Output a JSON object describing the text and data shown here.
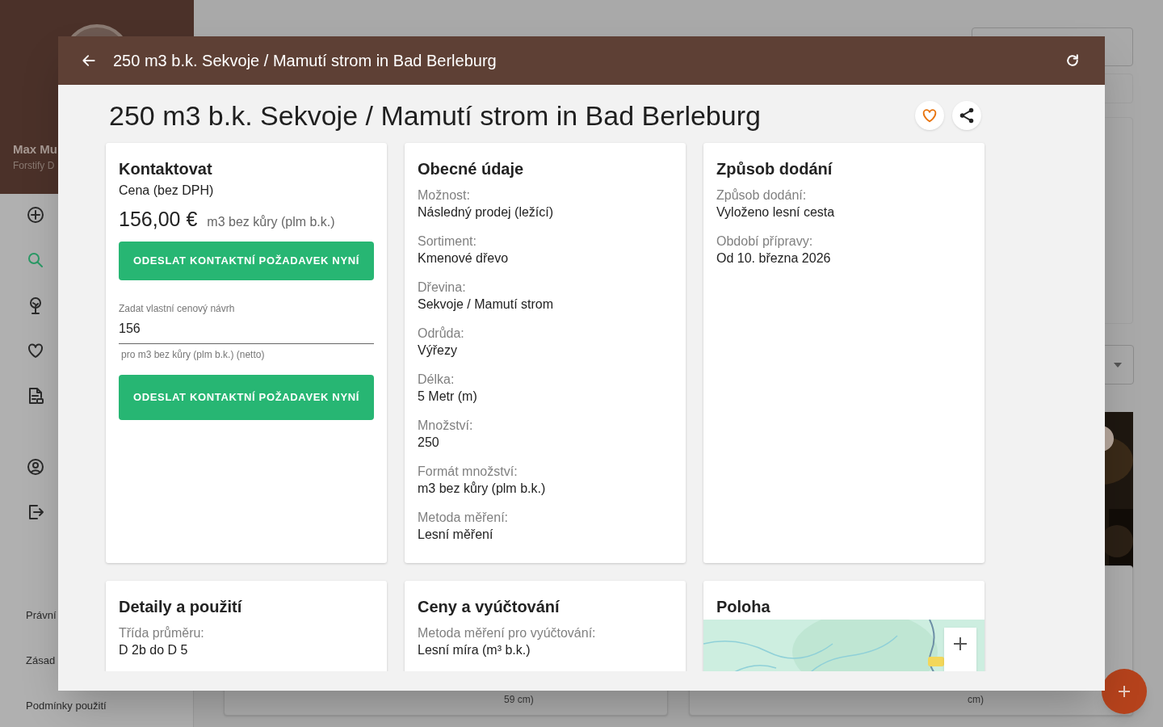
{
  "sidebar": {
    "user_name": "Max Mu",
    "user_subtitle": "Forstify D",
    "nav_items": [
      {
        "selected": false
      },
      {
        "selected": true
      },
      {
        "selected": false
      },
      {
        "selected": false
      },
      {
        "selected": false
      },
      {
        "selected": false
      },
      {
        "selected": false
      }
    ],
    "footer_links": [
      "Právní",
      "Zásad",
      "Podmínky použití"
    ]
  },
  "background": {
    "card_texts": [
      "59 cm)",
      "cm)"
    ]
  },
  "dialog": {
    "header_title": "250 m3 b.k. Sekvoje / Mamutí strom in Bad Berleburg",
    "title": "250 m3 b.k. Sekvoje / Mamutí strom in Bad Berleburg",
    "cards": [
      {
        "kind": "contact",
        "heading": "Kontaktovat",
        "price_label": "Cena (bez DPH)",
        "price": "156,00 €",
        "price_unit": "m3 bez kůry (plm b.k.)",
        "button": "ODESLAT KONTAKTNÍ POŽADAVEK NYNÍ",
        "offer_field": {
          "label": "Zadat vlastní cenový návrh",
          "value": "156",
          "hint": "pro m3 bez kůry (plm b.k.) (netto)"
        },
        "submit_button": "ODESLAT KONTAKTNÍ POŽADAVEK NYNÍ"
      },
      {
        "kind": "fields",
        "heading": "Obecné údaje",
        "fields": [
          {
            "label": "Možnost:",
            "value": "Následný prodej (ležící)"
          },
          {
            "label": "Sortiment:",
            "value": "Kmenové dřevo"
          },
          {
            "label": "Dřevina:",
            "value": "Sekvoje / Mamutí strom"
          },
          {
            "label": "Odrůda:",
            "value": "Výřezy"
          },
          {
            "label": "Délka:",
            "value": "5 Metr (m)"
          },
          {
            "label": "Množství:",
            "value": "250"
          },
          {
            "label": "Formát množství:",
            "value": "m3 bez kůry (plm b.k.)"
          },
          {
            "label": "Metoda měření:",
            "value": "Lesní měření"
          }
        ]
      },
      {
        "kind": "fields",
        "heading": "Způsob dodání",
        "fields": [
          {
            "label": "Způsob dodání:",
            "value": "Vyloženo lesní cesta"
          },
          {
            "label": "Období přípravy:",
            "value": "Od 10. března 2026"
          }
        ]
      },
      {
        "kind": "fields",
        "heading": "Detaily a použití",
        "fields": [
          {
            "label": "Třída průměru:",
            "value": "D 2b do D 5"
          }
        ]
      },
      {
        "kind": "fields",
        "heading": "Ceny a vyúčtování",
        "fields": [
          {
            "label": "Metoda měření pro vyúčtování:",
            "value": "Lesní míra (m³ b.k.)"
          }
        ]
      },
      {
        "kind": "map",
        "heading": "Poloha"
      }
    ]
  }
}
